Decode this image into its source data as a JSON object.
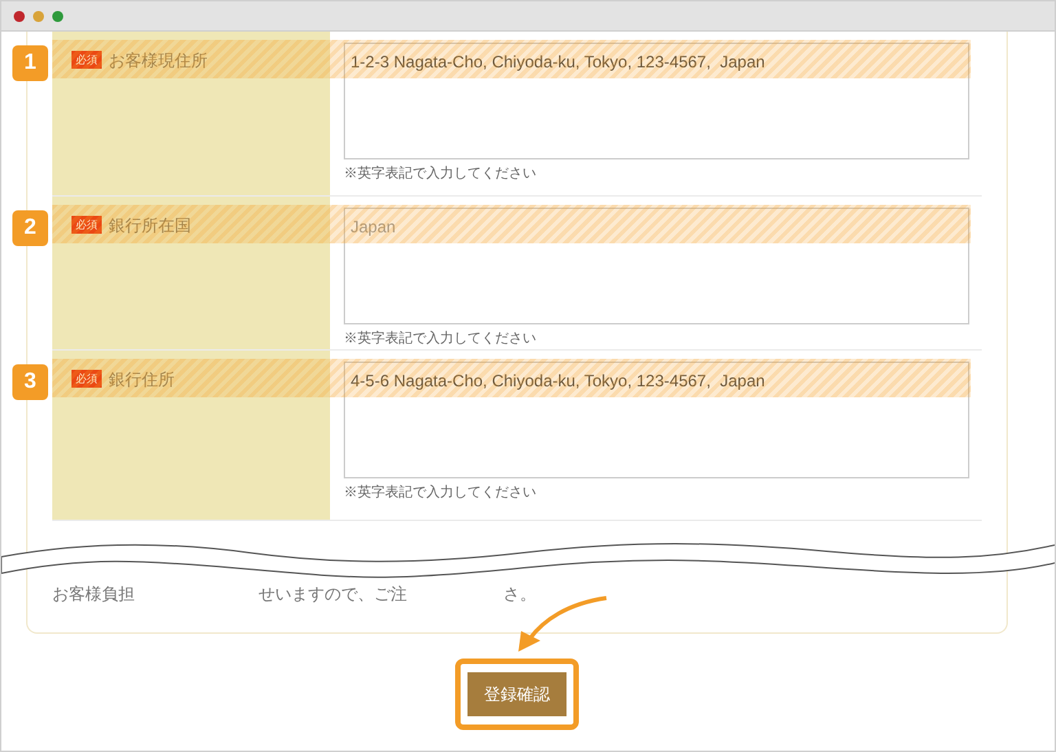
{
  "rows": [
    {
      "number": "1",
      "required": "必須",
      "label": "お客様現住所",
      "value": "1-2-3 Nagata-Cho, Chiyoda-ku, Tokyo, 123-4567,  Japan",
      "hint": "※英字表記で入力してください"
    },
    {
      "number": "2",
      "required": "必須",
      "label": "銀行所在国",
      "placeholder": "Japan",
      "hint": "※英字表記で入力してください"
    },
    {
      "number": "3",
      "required": "必須",
      "label": "銀行住所",
      "value": "4-5-6 Nagata-Cho, Chiyoda-ku, Tokyo, 123-4567,  Japan",
      "hint": "※英字表記で入力してください"
    }
  ],
  "note_fragments": [
    "お客様負担",
    "せいますので、ご注",
    "さ。"
  ],
  "submit_button": "登録確認"
}
